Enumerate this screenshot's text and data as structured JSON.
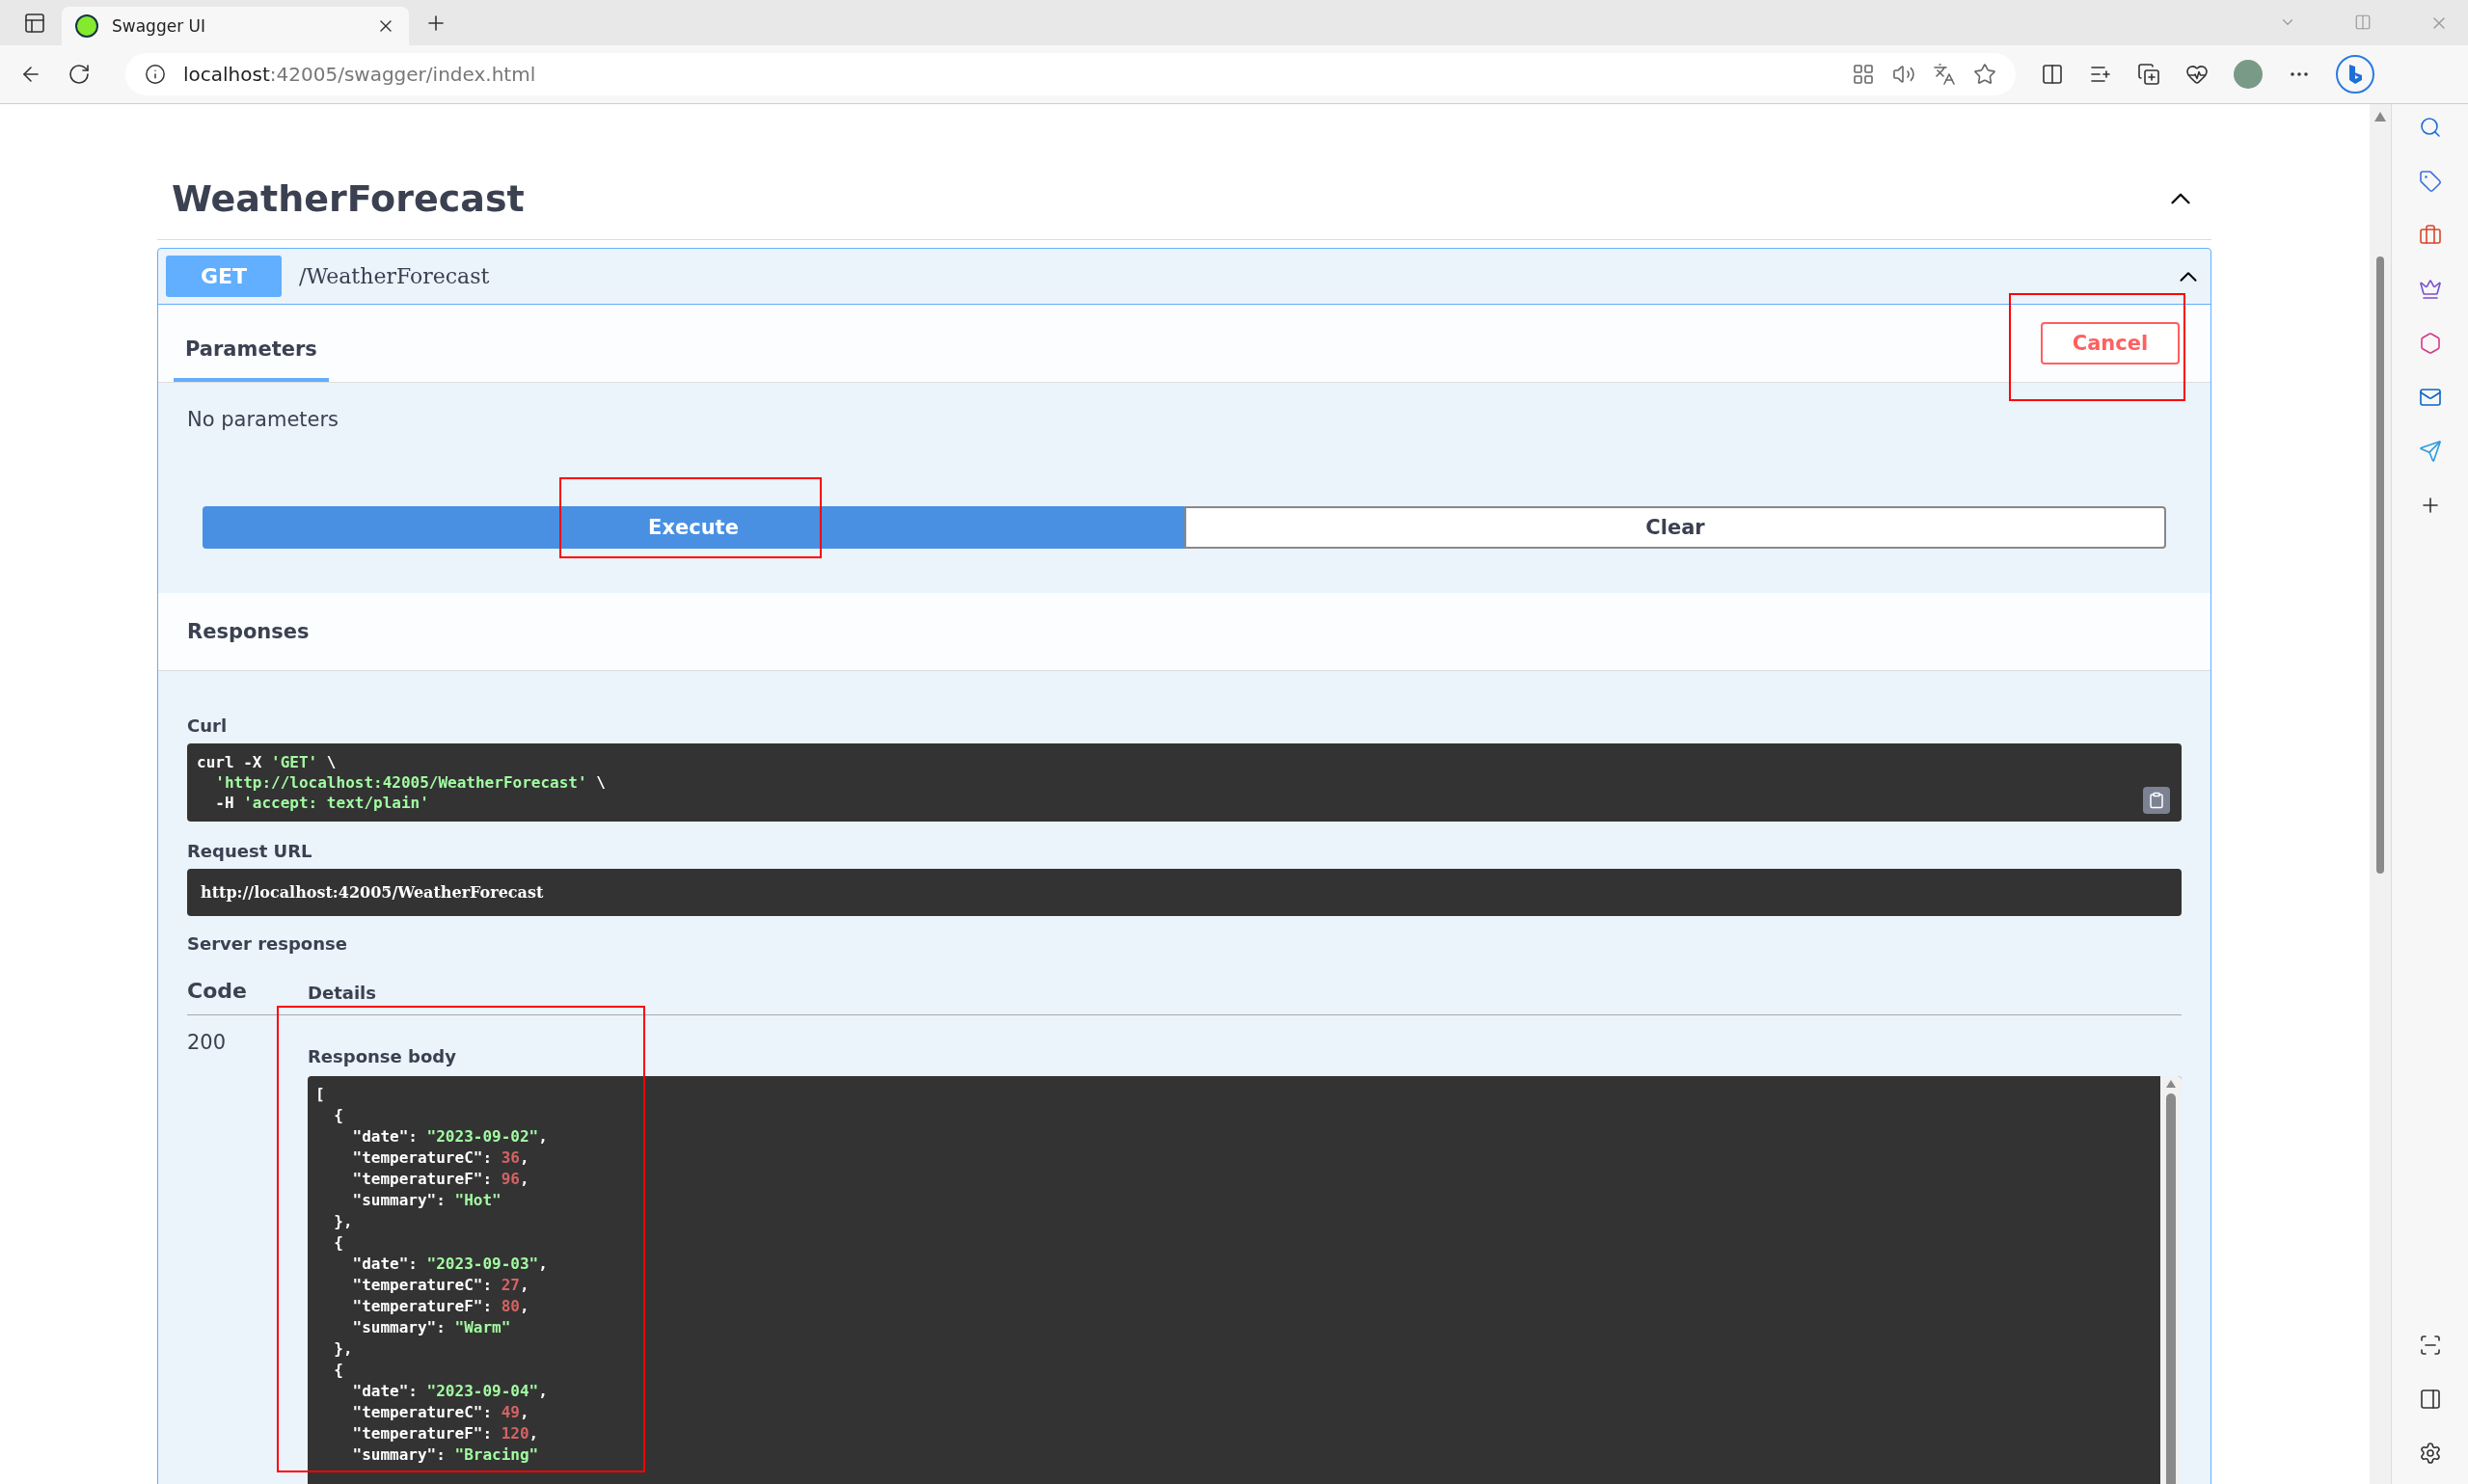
{
  "browser": {
    "tab_title": "Swagger UI",
    "url_host": "localhost",
    "url_rest": ":42005/swagger/index.html"
  },
  "section": {
    "title": "WeatherForecast",
    "expanded": true
  },
  "operation": {
    "method": "GET",
    "path": "/WeatherForecast",
    "expanded": true,
    "tabs": [
      {
        "label": "Parameters",
        "selected": true
      }
    ],
    "cancel": {
      "label": "Cancel",
      "highlighted": true
    },
    "parameters_note": "No parameters",
    "buttons": [
      {
        "label": "Execute",
        "kind": "primary",
        "highlighted": true
      },
      {
        "label": "Clear",
        "kind": "secondary",
        "highlighted": false
      }
    ],
    "responses_title": "Responses",
    "curl": {
      "label": "Curl",
      "lines": [
        [
          {
            "kind": "plain",
            "text": "curl -X "
          },
          {
            "kind": "string",
            "text": "'GET'"
          },
          {
            "kind": "plain",
            "text": " \\"
          }
        ],
        [
          {
            "kind": "string",
            "text": "  'http://localhost:42005/WeatherForecast'"
          },
          {
            "kind": "plain",
            "text": " \\"
          }
        ],
        [
          {
            "kind": "plain",
            "text": "  -H "
          },
          {
            "kind": "string",
            "text": "'accept: text/plain'"
          }
        ]
      ]
    },
    "request_url": {
      "label": "Request URL",
      "value": "http://localhost:42005/WeatherForecast"
    },
    "server_response": {
      "label": "Server response",
      "columns": [
        "Code",
        "Details"
      ],
      "code": "200",
      "body_label": "Response body",
      "body_highlighted": true,
      "body_lines": [
        [
          {
            "kind": "plain",
            "text": "["
          }
        ],
        [
          {
            "kind": "plain",
            "text": "  {"
          }
        ],
        [
          {
            "kind": "plain",
            "text": "    \"date\": "
          },
          {
            "kind": "string",
            "text": "\"2023-09-02\""
          },
          {
            "kind": "plain",
            "text": ","
          }
        ],
        [
          {
            "kind": "plain",
            "text": "    \"temperatureC\": "
          },
          {
            "kind": "number",
            "text": "36"
          },
          {
            "kind": "plain",
            "text": ","
          }
        ],
        [
          {
            "kind": "plain",
            "text": "    \"temperatureF\": "
          },
          {
            "kind": "number",
            "text": "96"
          },
          {
            "kind": "plain",
            "text": ","
          }
        ],
        [
          {
            "kind": "plain",
            "text": "    \"summary\": "
          },
          {
            "kind": "string",
            "text": "\"Hot\""
          }
        ],
        [
          {
            "kind": "plain",
            "text": "  },"
          }
        ],
        [
          {
            "kind": "plain",
            "text": "  {"
          }
        ],
        [
          {
            "kind": "plain",
            "text": "    \"date\": "
          },
          {
            "kind": "string",
            "text": "\"2023-09-03\""
          },
          {
            "kind": "plain",
            "text": ","
          }
        ],
        [
          {
            "kind": "plain",
            "text": "    \"temperatureC\": "
          },
          {
            "kind": "number",
            "text": "27"
          },
          {
            "kind": "plain",
            "text": ","
          }
        ],
        [
          {
            "kind": "plain",
            "text": "    \"temperatureF\": "
          },
          {
            "kind": "number",
            "text": "80"
          },
          {
            "kind": "plain",
            "text": ","
          }
        ],
        [
          {
            "kind": "plain",
            "text": "    \"summary\": "
          },
          {
            "kind": "string",
            "text": "\"Warm\""
          }
        ],
        [
          {
            "kind": "plain",
            "text": "  },"
          }
        ],
        [
          {
            "kind": "plain",
            "text": "  {"
          }
        ],
        [
          {
            "kind": "plain",
            "text": "    \"date\": "
          },
          {
            "kind": "string",
            "text": "\"2023-09-04\""
          },
          {
            "kind": "plain",
            "text": ","
          }
        ],
        [
          {
            "kind": "plain",
            "text": "    \"temperatureC\": "
          },
          {
            "kind": "number",
            "text": "49"
          },
          {
            "kind": "plain",
            "text": ","
          }
        ],
        [
          {
            "kind": "plain",
            "text": "    \"temperatureF\": "
          },
          {
            "kind": "number",
            "text": "120"
          },
          {
            "kind": "plain",
            "text": ","
          }
        ],
        [
          {
            "kind": "plain",
            "text": "    \"summary\": "
          },
          {
            "kind": "string",
            "text": "\"Bracing\""
          }
        ]
      ]
    }
  }
}
